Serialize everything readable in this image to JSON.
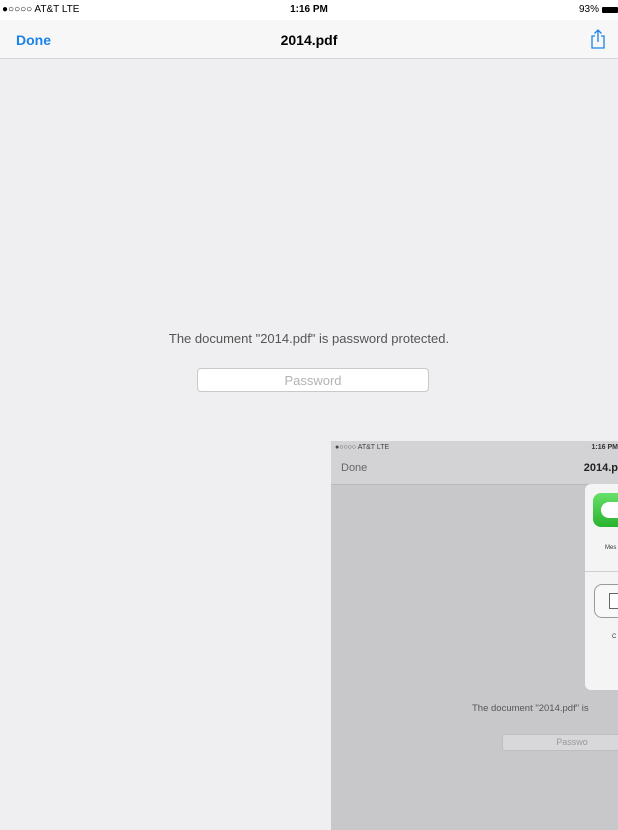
{
  "status": {
    "carrier": "●○○○○ AT&T  LTE",
    "time": "1:16 PM",
    "battery_percent": "93%"
  },
  "nav": {
    "done_label": "Done",
    "title": "2014.pdf",
    "share_icon": "share-icon"
  },
  "main": {
    "message": "The document \"2014.pdf\" is password protected.",
    "password_placeholder": "Password"
  },
  "thumbnail": {
    "carrier": "●○○○○ AT&T  LTE",
    "time": "1:16 PM",
    "done_label": "Done",
    "title": "2014.p",
    "share_items": [
      {
        "icon": "messages-icon",
        "label": "Mes"
      },
      {
        "icon": "copy-icon",
        "label": "C"
      }
    ],
    "message": "The document \"2014.pdf\" is",
    "password_placeholder": "Passwo"
  },
  "colors": {
    "accent": "#1a82ea",
    "background": "#efeff1"
  }
}
